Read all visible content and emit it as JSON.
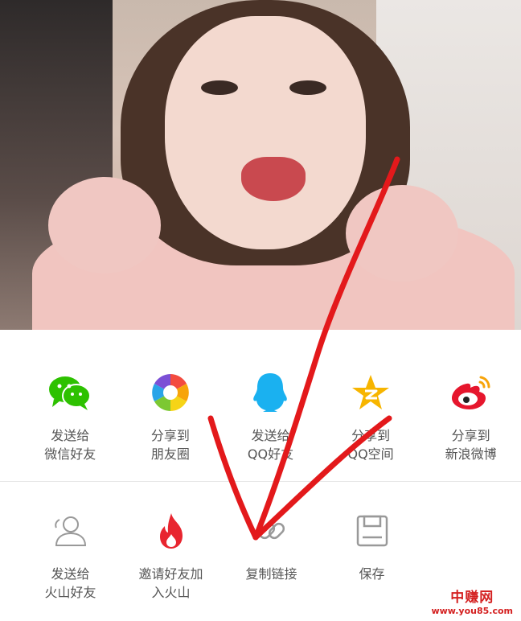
{
  "share_row_1": [
    {
      "icon": "wechat-icon",
      "label": "发送给\n微信好友"
    },
    {
      "icon": "moments-icon",
      "label": "分享到\n朋友圈"
    },
    {
      "icon": "qq-icon",
      "label": "发送给\nQQ好友"
    },
    {
      "icon": "qzone-icon",
      "label": "分享到\nQQ空间"
    },
    {
      "icon": "weibo-icon",
      "label": "分享到\n新浪微博"
    }
  ],
  "share_row_2": [
    {
      "icon": "huoshan-friend-icon",
      "label": "发送给\n火山好友"
    },
    {
      "icon": "flame-icon",
      "label": "邀请好友加\n入火山"
    },
    {
      "icon": "link-icon",
      "label": "复制链接"
    },
    {
      "icon": "save-icon",
      "label": "保存"
    }
  ],
  "colors": {
    "wechat": "#2dc100",
    "qq": "#1ab1f0",
    "qzone": "#f7b500",
    "weibo": "#e6162d",
    "flame": "#e8252f",
    "arrow": "#e3191b",
    "label": "#555555"
  },
  "watermark": {
    "brand": "中赚网",
    "url": "www.you85.com"
  }
}
